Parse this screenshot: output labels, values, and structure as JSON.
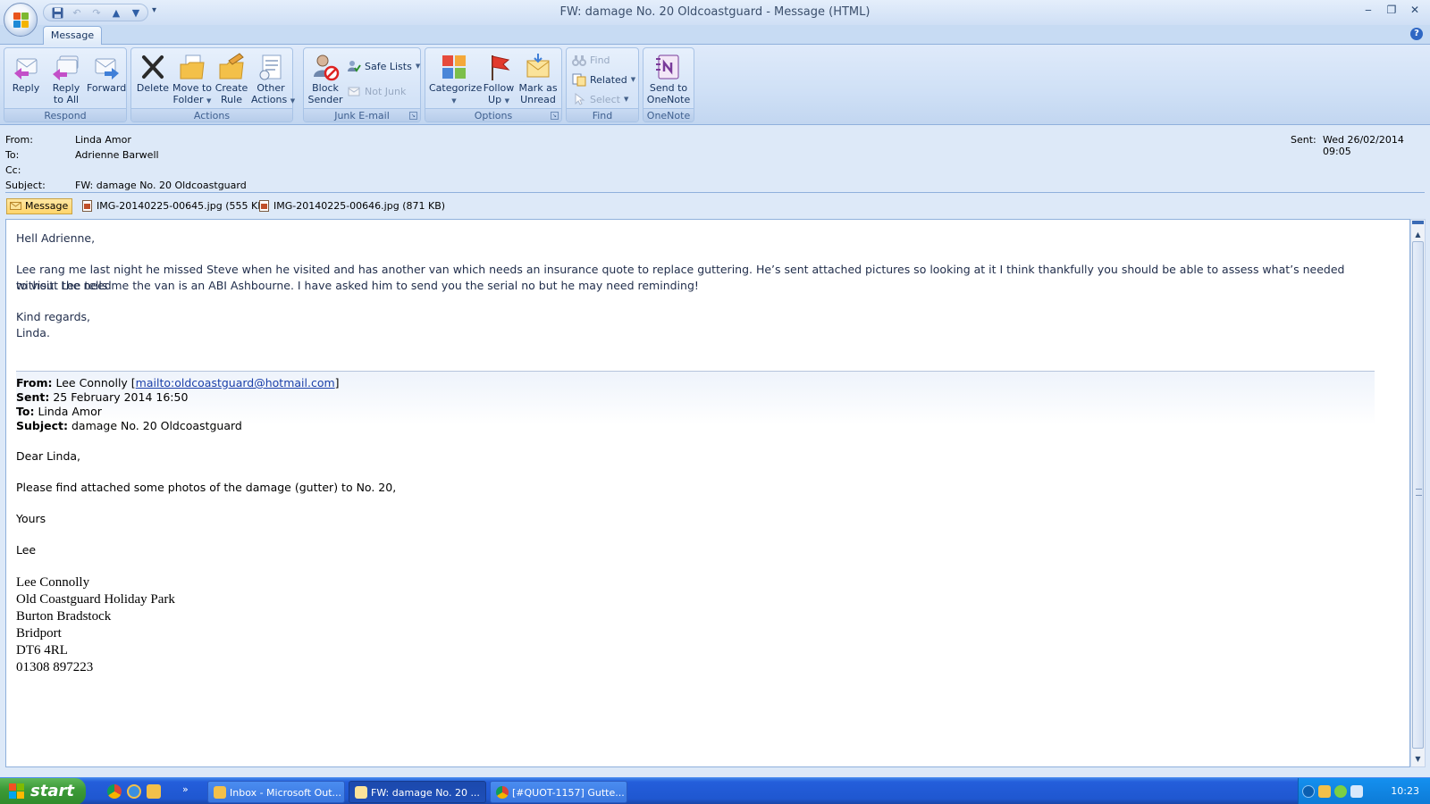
{
  "window": {
    "title": "FW: damage No. 20 Oldcoastguard - Message (HTML)",
    "controls": {
      "minimize": "‒",
      "restore": "❐",
      "close": "✕"
    }
  },
  "ribbon": {
    "tab": "Message",
    "groups": {
      "respond": {
        "label": "Respond",
        "reply": "Reply",
        "reply_all_1": "Reply",
        "reply_all_2": "to All",
        "forward": "Forward"
      },
      "actions": {
        "label": "Actions",
        "delete": "Delete",
        "move_1": "Move to",
        "move_2": "Folder",
        "create_1": "Create",
        "create_2": "Rule",
        "other_1": "Other",
        "other_2": "Actions"
      },
      "junk": {
        "label": "Junk E-mail",
        "block_1": "Block",
        "block_2": "Sender",
        "safe_lists": "Safe Lists",
        "not_junk": "Not Junk"
      },
      "options": {
        "label": "Options",
        "categorize": "Categorize",
        "follow_1": "Follow",
        "follow_2": "Up",
        "mark_1": "Mark as",
        "mark_2": "Unread"
      },
      "find": {
        "label": "Find",
        "find": "Find",
        "related": "Related",
        "select": "Select"
      },
      "onenote": {
        "label": "OneNote",
        "send_1": "Send to",
        "send_2": "OneNote"
      }
    }
  },
  "header": {
    "from_label": "From:",
    "from": "Linda Amor",
    "to_label": "To:",
    "to": "Adrienne Barwell",
    "cc_label": "Cc:",
    "cc": "",
    "subject_label": "Subject:",
    "subject": "FW: damage No. 20 Oldcoastguard",
    "sent_label": "Sent:",
    "sent": "Wed 26/02/2014 09:05"
  },
  "attachments": {
    "message": "Message",
    "items": [
      "IMG-20140225-00645.jpg (555 KB)",
      "IMG-20140225-00646.jpg (871 KB)"
    ]
  },
  "body": {
    "greeting": "Hell Adrienne,",
    "para1_line1": "Lee rang me last night he missed Steve when he visited and has another van which needs an insurance quote to replace guttering.  He’s sent attached pictures so looking at it I think thankfully you should be able to assess what’s needed without the need",
    "para1_line2": "to visit.  Lee tells me the van is an ABI Ashbourne.  I have asked him to send you the serial no but he may need reminding!",
    "regards": "Kind regards,",
    "sign": "Linda.",
    "forwarded": {
      "from_label": "From:",
      "from_name": "Lee Connolly",
      "from_link": "mailto:oldcoastguard@hotmail.com",
      "sent_label": "Sent:",
      "sent": "25 February 2014 16:50",
      "to_label": "To:",
      "to": "Linda Amor",
      "subject_label": "Subject:",
      "subject": "damage No. 20 Oldcoastguard",
      "greeting": "Dear Linda,",
      "line": "Please find attached some photos of the damage (gutter) to No. 20,",
      "closing": "Yours",
      "name": "Lee"
    },
    "signature": [
      "Lee Connolly",
      "Old Coastguard Holiday Park",
      "Burton Bradstock",
      "Bridport",
      "DT6 4RL",
      "01308 897223"
    ]
  },
  "taskbar": {
    "start": "start",
    "tasks": [
      {
        "label": "Inbox - Microsoft Out..."
      },
      {
        "label": "FW: damage No. 20 ..."
      },
      {
        "label": "[#QUOT-1157] Gutte..."
      }
    ],
    "clock": "10:23"
  }
}
